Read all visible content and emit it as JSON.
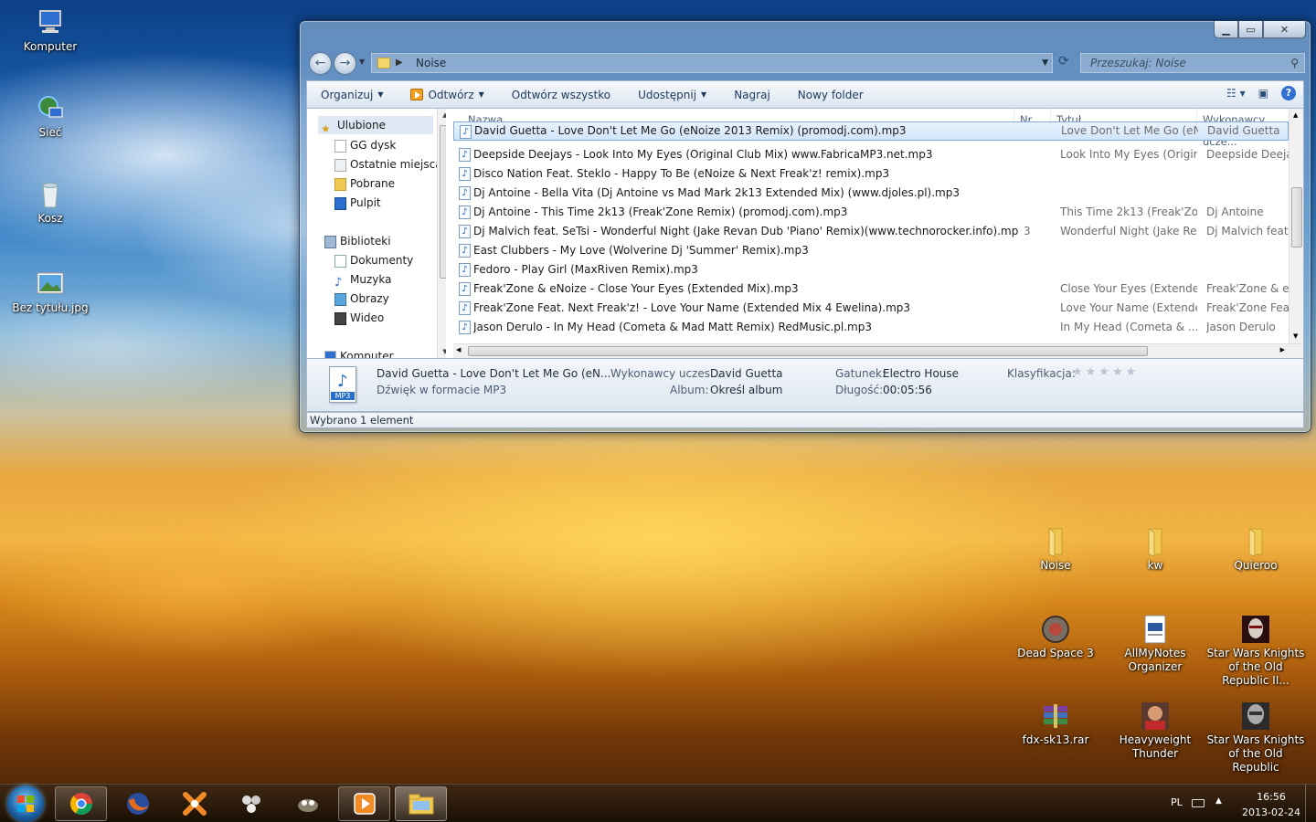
{
  "desktop": {
    "icons_left": [
      {
        "label": "Komputer",
        "icon": "computer-icon"
      },
      {
        "label": "Sieć",
        "icon": "network-icon"
      },
      {
        "label": "Kosz",
        "icon": "recycle-bin-icon"
      },
      {
        "label": "Bez tytułu.jpg",
        "icon": "image-file-icon"
      }
    ],
    "icons_right": [
      {
        "label": "Noise",
        "icon": "folder-icon"
      },
      {
        "label": "kw",
        "icon": "folder-icon"
      },
      {
        "label": "Quieroo",
        "icon": "folder-icon"
      },
      {
        "label": "Dead Space 3",
        "icon": "dead-space-icon"
      },
      {
        "label": "AllMyNotes Organizer",
        "icon": "notes-icon"
      },
      {
        "label": "Star Wars Knights of the Old Republic II...",
        "icon": "kotor2-icon"
      },
      {
        "label": "fdx-sk13.rar",
        "icon": "rar-archive-icon"
      },
      {
        "label": "Heavyweight Thunder",
        "icon": "boxer-icon"
      },
      {
        "label": "Star Wars Knights of the Old Republic",
        "icon": "kotor-icon"
      }
    ]
  },
  "explorer": {
    "address": {
      "path": "Noise"
    },
    "search": {
      "placeholder": "Przeszukaj: Noise"
    },
    "toolbar": {
      "organize": "Organizuj",
      "open": "Odtwórz",
      "play_all": "Odtwórz wszystko",
      "share": "Udostępnij",
      "burn": "Nagraj",
      "new_folder": "Nowy folder"
    },
    "nav": {
      "favorites": "Ulubione",
      "fav_items": [
        "GG dysk",
        "Ostatnie miejsca",
        "Pobrane",
        "Pulpit"
      ],
      "libraries": "Biblioteki",
      "lib_items": [
        "Dokumenty",
        "Muzyka",
        "Obrazy",
        "Wideo"
      ],
      "computer": "Komputer"
    },
    "columns": {
      "name": "Nazwa",
      "nr": "Nr",
      "title": "Tytuł",
      "artist": "Wykonawcy ucze..."
    },
    "files": [
      {
        "name": "David Guetta - Love Don't Let Me Go (eNoize 2013 Remix) (promodj.com).mp3",
        "nr": "",
        "title": "Love Don't Let Me Go (eN...",
        "artist": "David Guetta",
        "selected": true
      },
      {
        "name": "Deepside Deejays - Look Into My Eyes (Original Club Mix) www.FabricaMP3.net.mp3",
        "nr": "",
        "title": "Look Into My Eyes (Origin...",
        "artist": "Deepside Deejays",
        "selected": false
      },
      {
        "name": "Disco Nation Feat. Steklo - Happy To Be (eNoize & Next Freak'z! remix).mp3",
        "nr": "",
        "title": "",
        "artist": "",
        "selected": false
      },
      {
        "name": "Dj Antoine - Bella Vita (Dj Antoine vs Mad Mark 2k13 Extended Mix) (www.djoles.pl).mp3",
        "nr": "",
        "title": "",
        "artist": "",
        "selected": false
      },
      {
        "name": "Dj Antoine - This Time 2k13 (Freak'Zone Remix) (promodj.com).mp3",
        "nr": "",
        "title": "This Time 2k13 (Freak'Zo...",
        "artist": "Dj Antoine",
        "selected": false
      },
      {
        "name": "Dj Malvich feat. SeTsi - Wonderful Night (Jake Revan Dub 'Piano' Remix)(www.technorocker.info).mp3",
        "nr": "3",
        "title": "Wonderful Night (Jake Re...",
        "artist": "Dj Malvich feat. S",
        "selected": false
      },
      {
        "name": "East Clubbers - My Love (Wolverine Dj 'Summer' Remix).mp3",
        "nr": "",
        "title": "",
        "artist": "",
        "selected": false
      },
      {
        "name": "Fedoro - Play Girl (MaxRiven Remix).mp3",
        "nr": "",
        "title": "",
        "artist": "",
        "selected": false
      },
      {
        "name": "Freak'Zone & eNoize - Close Your Eyes (Extended Mix).mp3",
        "nr": "",
        "title": "Close Your Eyes (Extende...",
        "artist": "Freak'Zone & eN",
        "selected": false
      },
      {
        "name": "Freak'Zone Feat. Next Freak'z! - Love Your Name (Extended Mix 4 Ewelina).mp3",
        "nr": "",
        "title": "Love Your Name (Extende...",
        "artist": "Freak'Zone Feat.",
        "selected": false
      },
      {
        "name": "Jason Derulo - In My Head  (Cometa & Mad Matt Remix) RedMusic.pl.mp3",
        "nr": "",
        "title": "In My Head  (Cometa & ...",
        "artist": "Jason Derulo",
        "selected": false
      }
    ],
    "details": {
      "file_title": "David Guetta - Love Don't Let Me Go (eN...",
      "file_type": "Dźwięk w formacie MP3",
      "artists_label": "Wykonawcy uczes...",
      "artists_value": "David Guetta",
      "album_label": "Album:",
      "album_value": "Określ album",
      "genre_label": "Gatunek:",
      "genre_value": "Electro House",
      "length_label": "Długość:",
      "length_value": "00:05:56",
      "rating_label": "Klasyfikacja:",
      "rating_stars": "★★★★★",
      "rating_value": 0
    },
    "status": "Wybrano 1 element"
  },
  "taskbar": {
    "apps": [
      "chrome-icon",
      "firefox-icon",
      "app-icon-x",
      "app-icon-hex",
      "gimp-icon",
      "media-player-icon",
      "explorer-icon"
    ],
    "tray": {
      "lang": "PL",
      "time": "16:56",
      "date": "2013-02-24"
    }
  },
  "colors": {
    "selection": "#d2e5fb",
    "accent": "#2e6fcf"
  }
}
